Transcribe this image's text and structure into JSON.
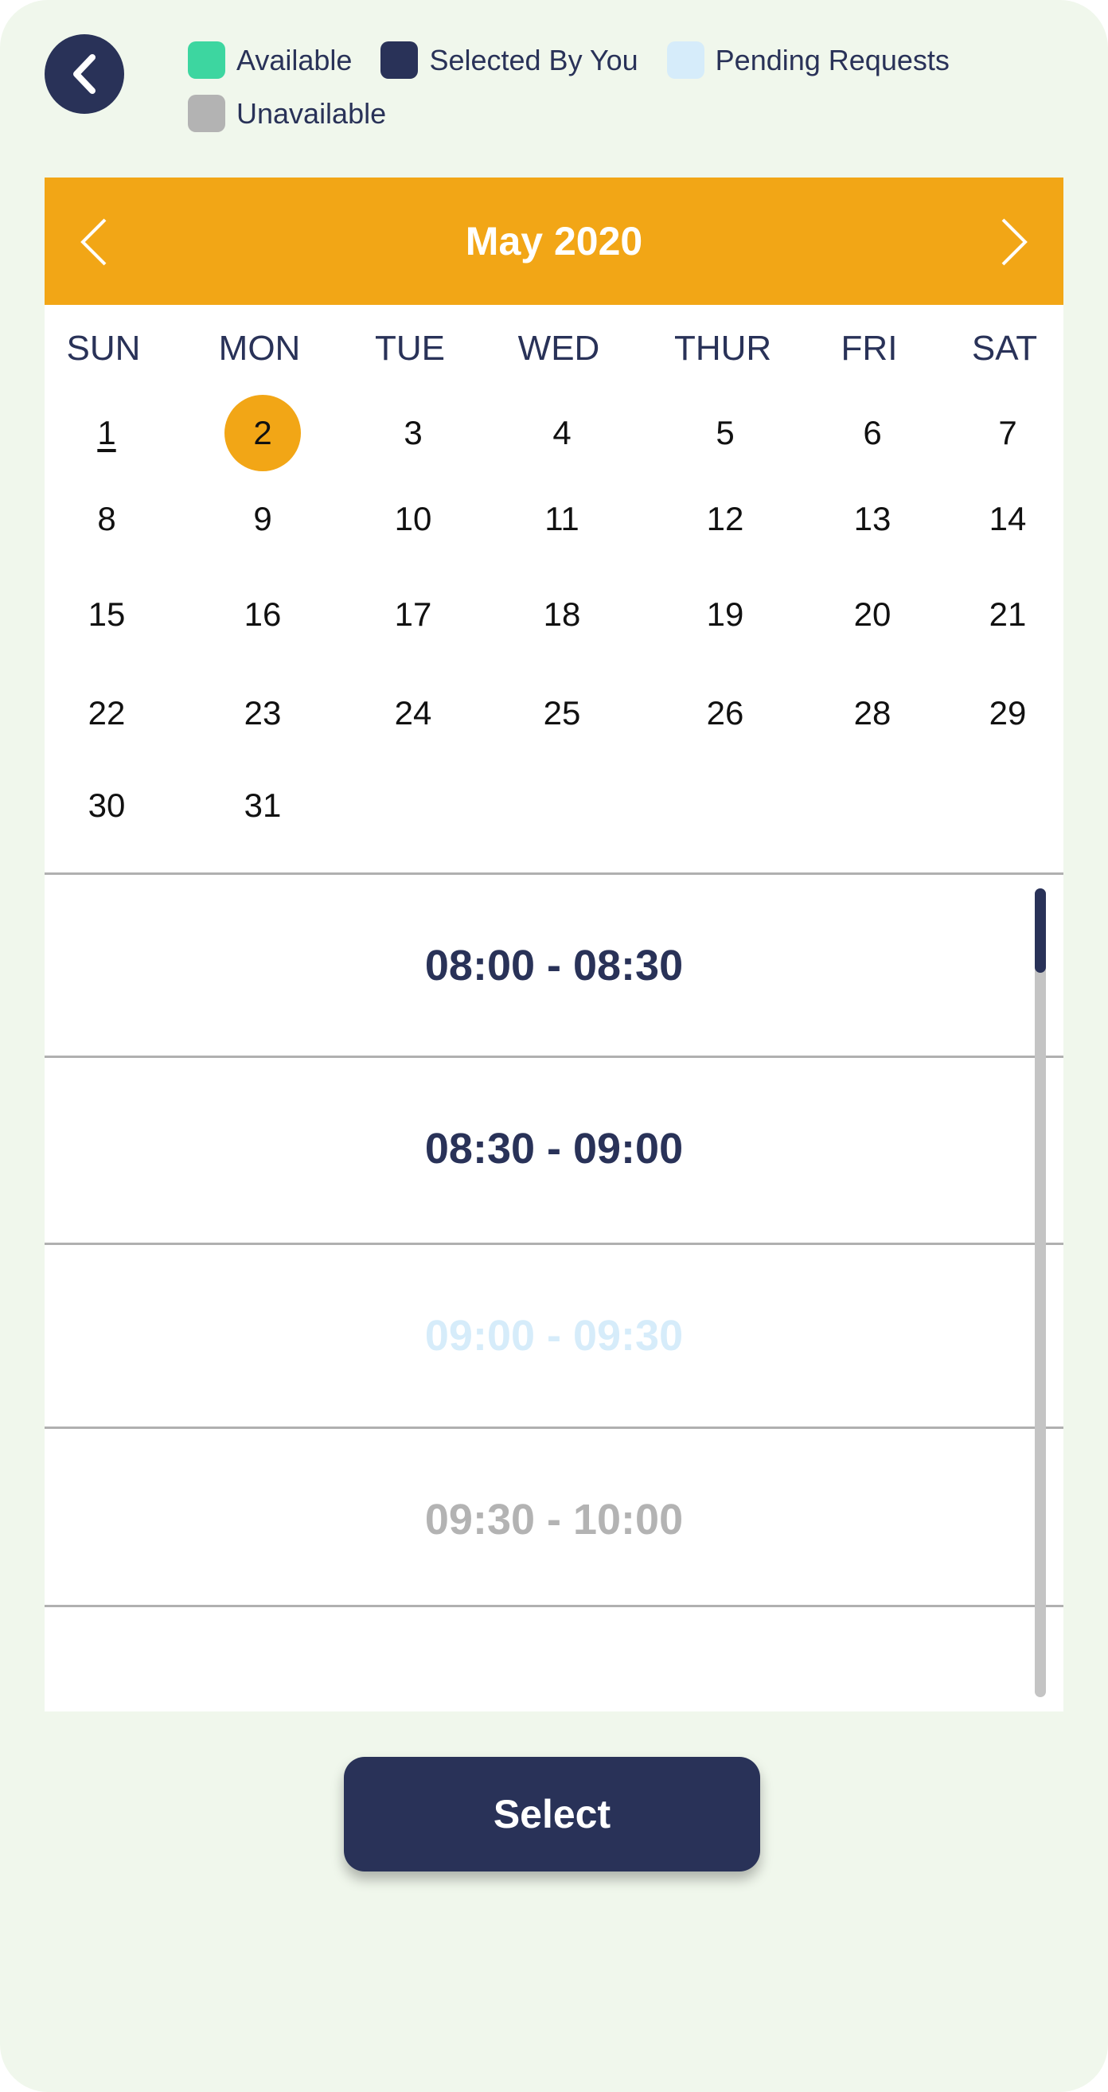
{
  "back_button": {
    "icon": "chevron-left-icon"
  },
  "legend": [
    {
      "label": "Available",
      "color": "#3dd6a0"
    },
    {
      "label": "Selected By You",
      "color": "#293258"
    },
    {
      "label": "Pending Requests",
      "color": "#d6ecfa"
    },
    {
      "label": "Unavailable",
      "color": "#b3b3b3"
    }
  ],
  "calendar": {
    "month_title": "May 2020",
    "prev_icon": "chevron-left-icon",
    "next_icon": "chevron-right-icon",
    "accent_color": "#f2a616",
    "weekdays": [
      "SUN",
      "MON",
      "TUE",
      "WED",
      "THUR",
      "FRI",
      "SAT"
    ],
    "weeks": [
      [
        "1",
        "2",
        "3",
        "4",
        "5",
        "6",
        "7"
      ],
      [
        "8",
        "9",
        "10",
        "11",
        "12",
        "13",
        "14"
      ],
      [
        "15",
        "16",
        "17",
        "18",
        "19",
        "20",
        "21"
      ],
      [
        "22",
        "23",
        "24",
        "25",
        "26",
        "28",
        "29"
      ],
      [
        "30",
        "31",
        "",
        "",
        "",
        "",
        ""
      ]
    ],
    "selected_day": "2",
    "today_day": "1"
  },
  "time_slots": [
    {
      "label": "08:00 - 08:30",
      "status": "selected",
      "color": "#293258"
    },
    {
      "label": "08:30 - 09:00",
      "status": "selected",
      "color": "#293258"
    },
    {
      "label": "09:00 - 09:30",
      "status": "pending",
      "color": "#d6ecfa"
    },
    {
      "label": "09:30 - 10:00",
      "status": "unavailable",
      "color": "#b3b3b3"
    }
  ],
  "select_button": {
    "label": "Select"
  }
}
